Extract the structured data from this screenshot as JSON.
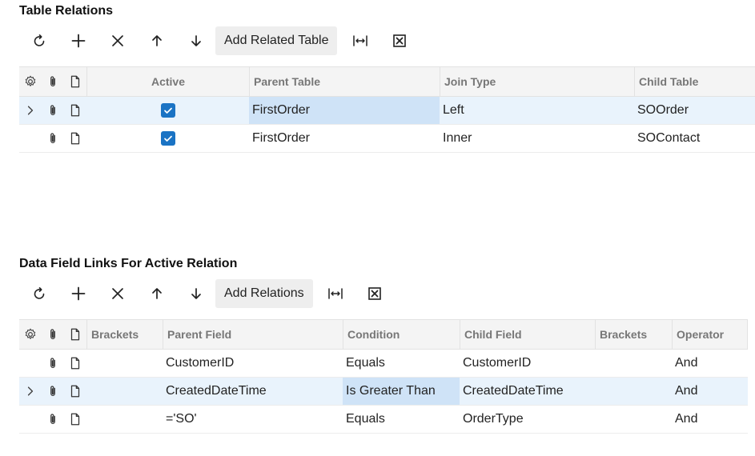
{
  "table_relations": {
    "title": "Table Relations",
    "toolbar": {
      "refresh_icon": "refresh-icon",
      "add_icon": "plus-icon",
      "delete_icon": "close-icon",
      "up_icon": "arrow-up-icon",
      "down_icon": "arrow-down-icon",
      "add_related_label": "Add Related Table",
      "fit_icon": "fit-columns-icon",
      "excel_icon": "excel-export-icon"
    },
    "columns": [
      "Active",
      "Parent Table",
      "Join Type",
      "Child Table"
    ],
    "rows": [
      {
        "active": true,
        "parent_table": "FirstOrder",
        "join_type": "Left",
        "child_table": "SOOrder",
        "selected": true
      },
      {
        "active": true,
        "parent_table": "FirstOrder",
        "join_type": "Inner",
        "child_table": "SOContact",
        "selected": false
      }
    ]
  },
  "data_field_links": {
    "title": "Data Field Links For Active Relation",
    "toolbar": {
      "add_relations_label": "Add Relations"
    },
    "columns": [
      "Brackets",
      "Parent Field",
      "Condition",
      "Child Field",
      "Brackets",
      "Operator"
    ],
    "rows": [
      {
        "brackets_open": "",
        "parent_field": "CustomerID",
        "condition": "Equals",
        "child_field": "CustomerID",
        "brackets_close": "",
        "operator": "And",
        "selected": false
      },
      {
        "brackets_open": "",
        "parent_field": "CreatedDateTime",
        "condition": "Is Greater Than",
        "child_field": "CreatedDateTime",
        "brackets_close": "",
        "operator": "And",
        "selected": true
      },
      {
        "brackets_open": "",
        "parent_field": "='SO'",
        "condition": "Equals",
        "child_field": "OrderType",
        "brackets_close": "",
        "operator": "And",
        "selected": false
      }
    ]
  },
  "colors": {
    "accent": "#1a73c4",
    "selected_row": "#e9f3fc",
    "active_cell": "#cfe3f7"
  }
}
